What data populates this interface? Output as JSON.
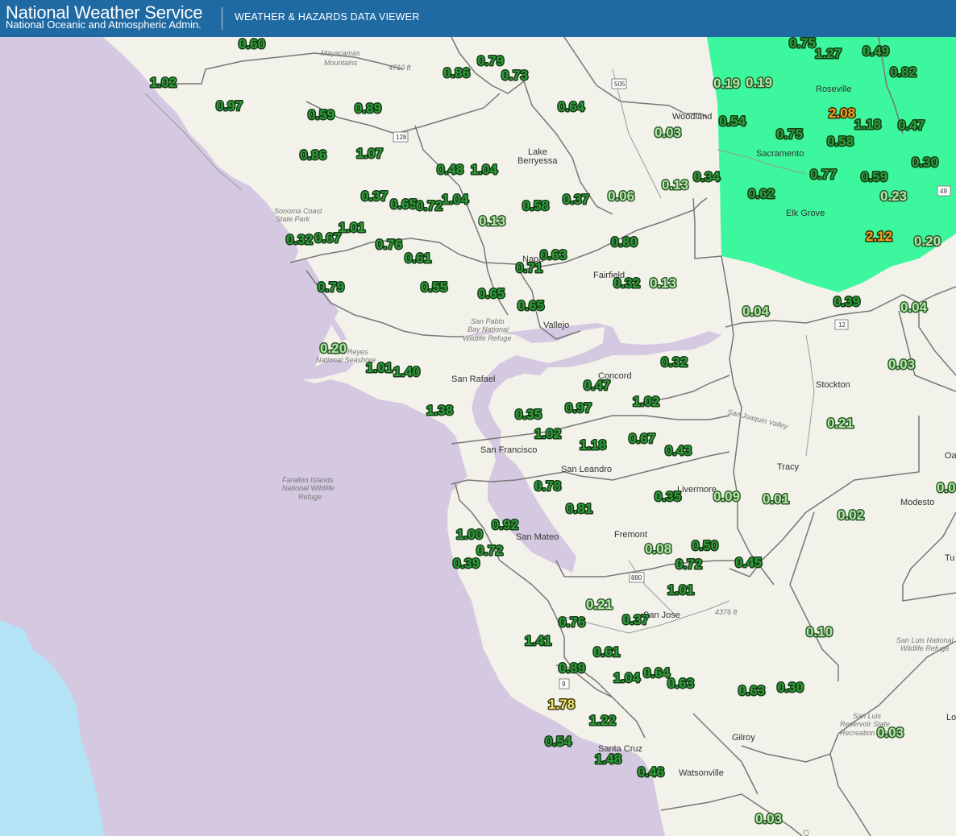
{
  "header": {
    "title": "National Weather Service",
    "subtitle": "National Oceanic and Atmospheric Admin.",
    "viewer": "WEATHER & HAZARDS DATA VIEWER"
  },
  "colors": {
    "header_bg": "#1f6aa3",
    "ocean": "#d5c9e2",
    "deep_ocean": "#b4e3f6",
    "land": "#f2f1ea",
    "hazard_area": "#2cf796",
    "value_dark": "#2f9e3c",
    "value_light": "#b4e6a6",
    "value_orange": "#f2a51e",
    "value_yellow": "#f2e46a"
  },
  "places": [
    "Mayacamas",
    "Mountains",
    "4710 ft",
    "Woodland",
    "Roseville",
    "Sacramento",
    "Elk Grove",
    "Lake",
    "Berryessa",
    "Sonoma Coast",
    "State Park",
    "Napa",
    "Fairfield",
    "Vallejo",
    "San Pablo",
    "Bay National",
    "Wildlife Refuge",
    "Point Reyes",
    "National Seashore",
    "San Rafael",
    "Concord",
    "San Francisco",
    "San Leandro",
    "Livermore",
    "Tracy",
    "Stockton",
    "San Joaquin Valley",
    "Modesto",
    "Farallon Islands",
    "National Wildlife",
    "Refuge",
    "San Mateo",
    "Fremont",
    "San Jose",
    "4376 ft",
    "Santa Cruz",
    "Watsonville",
    "Gilroy",
    "San Luis National",
    "Wildlife Refuge",
    "San Luis",
    "Reservoir State",
    "Recreation Area",
    "Coast",
    "Oa",
    "Tu",
    "Lo",
    "505",
    "128",
    "12",
    "49",
    "880",
    "9"
  ],
  "observations": [
    {
      "value": "0.60",
      "level": "dark"
    },
    {
      "value": "0.79",
      "level": "dark"
    },
    {
      "value": "0.86",
      "level": "dark"
    },
    {
      "value": "0.73",
      "level": "dark"
    },
    {
      "value": "1.02",
      "level": "dark"
    },
    {
      "value": "0.97",
      "level": "dark"
    },
    {
      "value": "0.59",
      "level": "dark"
    },
    {
      "value": "0.89",
      "level": "dark"
    },
    {
      "value": "0.64",
      "level": "dark"
    },
    {
      "value": "0.86",
      "level": "dark"
    },
    {
      "value": "1.07",
      "level": "dark"
    },
    {
      "value": "0.48",
      "level": "dark"
    },
    {
      "value": "1.04",
      "level": "dark"
    },
    {
      "value": "0.37",
      "level": "dark"
    },
    {
      "value": "0.65",
      "level": "dark"
    },
    {
      "value": "0.72",
      "level": "dark"
    },
    {
      "value": "1.04",
      "level": "dark"
    },
    {
      "value": "0.58",
      "level": "dark"
    },
    {
      "value": "0.37",
      "level": "dark"
    },
    {
      "value": "0.06",
      "level": "light"
    },
    {
      "value": "0.13",
      "level": "light"
    },
    {
      "value": "0.32",
      "level": "dark"
    },
    {
      "value": "0.67",
      "level": "dark"
    },
    {
      "value": "1.01",
      "level": "dark"
    },
    {
      "value": "0.76",
      "level": "dark"
    },
    {
      "value": "0.61",
      "level": "dark"
    },
    {
      "value": "0.80",
      "level": "dark"
    },
    {
      "value": "0.63",
      "level": "dark"
    },
    {
      "value": "0.71",
      "level": "dark"
    },
    {
      "value": "0.32",
      "level": "dark"
    },
    {
      "value": "0.13",
      "level": "light"
    },
    {
      "value": "0.79",
      "level": "dark"
    },
    {
      "value": "0.55",
      "level": "dark"
    },
    {
      "value": "0.65",
      "level": "dark"
    },
    {
      "value": "0.65",
      "level": "dark"
    },
    {
      "value": "0.20",
      "level": "light"
    },
    {
      "value": "1.01",
      "level": "dark"
    },
    {
      "value": "1.40",
      "level": "dark"
    },
    {
      "value": "0.32",
      "level": "dark"
    },
    {
      "value": "0.47",
      "level": "dark"
    },
    {
      "value": "1.38",
      "level": "dark"
    },
    {
      "value": "0.35",
      "level": "dark"
    },
    {
      "value": "0.97",
      "level": "dark"
    },
    {
      "value": "1.02",
      "level": "dark"
    },
    {
      "value": "1.02",
      "level": "dark"
    },
    {
      "value": "1.18",
      "level": "dark"
    },
    {
      "value": "0.67",
      "level": "dark"
    },
    {
      "value": "0.43",
      "level": "dark"
    },
    {
      "value": "0.78",
      "level": "dark"
    },
    {
      "value": "0.35",
      "level": "dark"
    },
    {
      "value": "0.09",
      "level": "light"
    },
    {
      "value": "0.01",
      "level": "light"
    },
    {
      "value": "0.81",
      "level": "dark"
    },
    {
      "value": "0.92",
      "level": "dark"
    },
    {
      "value": "1.00",
      "level": "dark"
    },
    {
      "value": "0.72",
      "level": "dark"
    },
    {
      "value": "0.39",
      "level": "dark"
    },
    {
      "value": "0.08",
      "level": "light"
    },
    {
      "value": "0.50",
      "level": "dark"
    },
    {
      "value": "0.72",
      "level": "dark"
    },
    {
      "value": "0.45",
      "level": "dark"
    },
    {
      "value": "1.01",
      "level": "dark"
    },
    {
      "value": "0.21",
      "level": "light"
    },
    {
      "value": "0.76",
      "level": "dark"
    },
    {
      "value": "0.37",
      "level": "dark"
    },
    {
      "value": "1.41",
      "level": "dark"
    },
    {
      "value": "0.61",
      "level": "dark"
    },
    {
      "value": "0.89",
      "level": "dark"
    },
    {
      "value": "1.04",
      "level": "dark"
    },
    {
      "value": "0.64",
      "level": "dark"
    },
    {
      "value": "0.63",
      "level": "dark"
    },
    {
      "value": "1.78",
      "level": "yellow"
    },
    {
      "value": "1.22",
      "level": "dark"
    },
    {
      "value": "0.54",
      "level": "dark"
    },
    {
      "value": "1.48",
      "level": "dark"
    },
    {
      "value": "0.46",
      "level": "dark"
    },
    {
      "value": "0.63",
      "level": "dark"
    },
    {
      "value": "0.30",
      "level": "dark"
    },
    {
      "value": "0.10",
      "level": "light"
    },
    {
      "value": "0.03",
      "level": "light"
    },
    {
      "value": "0.03",
      "level": "light"
    },
    {
      "value": "0.04",
      "level": "light"
    },
    {
      "value": "0.39",
      "level": "dark"
    },
    {
      "value": "0.04",
      "level": "light"
    },
    {
      "value": "0.03",
      "level": "light"
    },
    {
      "value": "0.21",
      "level": "light"
    },
    {
      "value": "0.02",
      "level": "light"
    },
    {
      "value": "0.0",
      "level": "light"
    },
    {
      "value": "0.75",
      "level": "dark"
    },
    {
      "value": "1.27",
      "level": "dark"
    },
    {
      "value": "0.49",
      "level": "dark"
    },
    {
      "value": "0.82",
      "level": "dark"
    },
    {
      "value": "0.19",
      "level": "light"
    },
    {
      "value": "0.19",
      "level": "light"
    },
    {
      "value": "0.03",
      "level": "light"
    },
    {
      "value": "0.54",
      "level": "dark"
    },
    {
      "value": "2.08",
      "level": "orange"
    },
    {
      "value": "1.18",
      "level": "dark"
    },
    {
      "value": "0.47",
      "level": "dark"
    },
    {
      "value": "0.75",
      "level": "dark"
    },
    {
      "value": "0.58",
      "level": "dark"
    },
    {
      "value": "0.30",
      "level": "dark"
    },
    {
      "value": "0.13",
      "level": "light"
    },
    {
      "value": "0.34",
      "level": "dark"
    },
    {
      "value": "0.77",
      "level": "dark"
    },
    {
      "value": "0.59",
      "level": "dark"
    },
    {
      "value": "0.62",
      "level": "dark"
    },
    {
      "value": "0.23",
      "level": "light"
    },
    {
      "value": "2.12",
      "level": "orange"
    },
    {
      "value": "0.20",
      "level": "light"
    }
  ]
}
